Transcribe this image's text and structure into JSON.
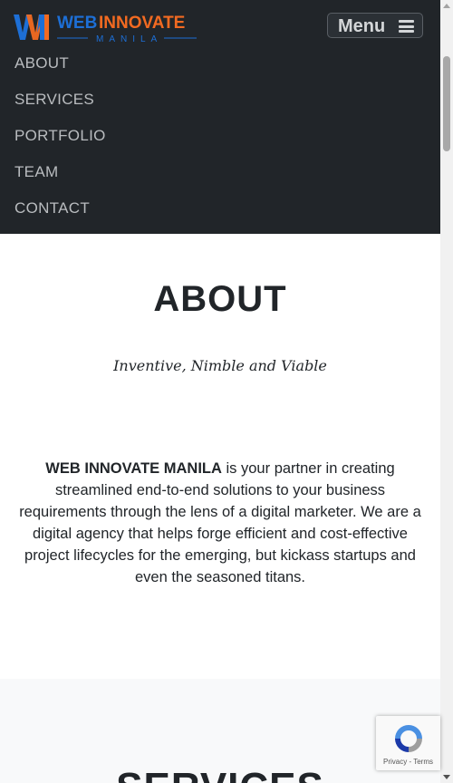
{
  "brand": {
    "logo_word1": "WEB",
    "logo_word2": "INNOVATE",
    "logo_sub": "MANILA",
    "colors": {
      "blue": "#1d6fd6",
      "orange": "#f26a21"
    }
  },
  "header": {
    "menu_label": "Menu"
  },
  "nav": {
    "items": [
      {
        "label": "ABOUT"
      },
      {
        "label": "SERVICES"
      },
      {
        "label": "PORTFOLIO"
      },
      {
        "label": "TEAM"
      },
      {
        "label": "CONTACT"
      }
    ]
  },
  "about": {
    "title": "ABOUT",
    "subtitle": "Inventive, Nimble and Viable",
    "body_bold": "WEB INNOVATE MANILA",
    "body_rest": " is your partner in creating streamlined end-to-end solutions to your business requirements through the lens of a digital marketer. We are a digital agency that helps forge efficient and cost-effective project lifecycles for the emerging, but kickass startups and even the seasoned titans."
  },
  "services": {
    "title": "SERVICES"
  },
  "recaptcha": {
    "privacy": "Privacy",
    "separator": " - ",
    "terms": "Terms"
  },
  "colors": {
    "nav_bg": "#212529",
    "section_alt_bg": "#f8f9fa"
  }
}
